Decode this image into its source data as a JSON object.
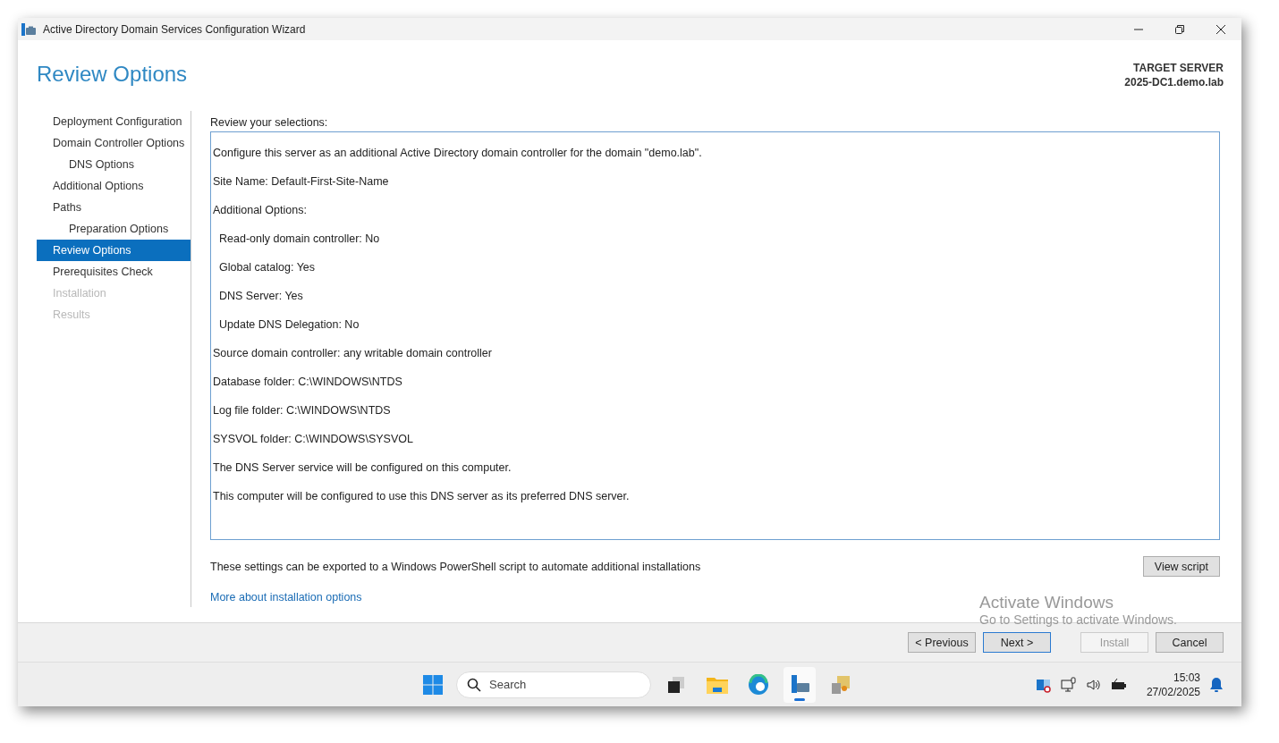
{
  "window": {
    "title": "Active Directory Domain Services Configuration Wizard"
  },
  "page": {
    "heading": "Review Options",
    "target_label": "TARGET SERVER",
    "target_name": "2025-DC1.demo.lab"
  },
  "steps": [
    {
      "label": "Deployment Configuration",
      "selected": false,
      "disabled": false
    },
    {
      "label": "Domain Controller Options",
      "selected": false,
      "disabled": false,
      "children": [
        {
          "label": "DNS Options",
          "selected": false,
          "disabled": false
        }
      ]
    },
    {
      "label": "Additional Options",
      "selected": false,
      "disabled": false
    },
    {
      "label": "Paths",
      "selected": false,
      "disabled": false,
      "children": [
        {
          "label": "Preparation Options",
          "selected": false,
          "disabled": false
        }
      ]
    },
    {
      "label": "Review Options",
      "selected": true,
      "disabled": false
    },
    {
      "label": "Prerequisites Check",
      "selected": false,
      "disabled": false
    },
    {
      "label": "Installation",
      "selected": false,
      "disabled": true
    },
    {
      "label": "Results",
      "selected": false,
      "disabled": true
    }
  ],
  "review": {
    "label": "Review your selections:",
    "lines": [
      {
        "text": "Configure this server as an additional Active Directory domain controller for the domain \"demo.lab\"."
      },
      {
        "text": "Site Name: Default-First-Site-Name"
      },
      {
        "text": "Additional Options:",
        "children": [
          {
            "text": "Read-only domain controller: No"
          },
          {
            "text": "Global catalog: Yes"
          },
          {
            "text": "DNS Server: Yes"
          },
          {
            "text": "Update DNS Delegation: No"
          }
        ]
      },
      {
        "text": "Source domain controller: any writable domain controller"
      },
      {
        "text": "Database folder: C:\\WINDOWS\\NTDS"
      },
      {
        "text": "Log file folder: C:\\WINDOWS\\NTDS"
      },
      {
        "text": "SYSVOL folder: C:\\WINDOWS\\SYSVOL"
      },
      {
        "text": "The DNS Server service will be configured on this computer."
      },
      {
        "text": "This computer will be configured to use this DNS server as its preferred DNS server."
      }
    ]
  },
  "export_note": "These settings can be exported to a Windows PowerShell script to automate additional installations",
  "view_script_button": "View script",
  "more_link": "More about installation options",
  "activation": {
    "title": "Activate Windows",
    "subtitle": "Go to Settings to activate Windows."
  },
  "buttons": [
    {
      "label": "< Previous",
      "disabled": false,
      "default": false
    },
    {
      "label": "Next >",
      "disabled": false,
      "default": true
    },
    {
      "label": "Install",
      "disabled": true,
      "default": false
    },
    {
      "label": "Cancel",
      "disabled": false,
      "default": false
    }
  ],
  "taskbar": {
    "search_placeholder": "Search",
    "apps": [
      {
        "kind": "taskview",
        "active": false
      },
      {
        "kind": "folder",
        "active": false
      },
      {
        "kind": "browser",
        "active": false
      },
      {
        "kind": "server",
        "active": true
      },
      {
        "kind": "installer",
        "active": false
      }
    ],
    "time": "15:03",
    "date": "27/02/2025"
  }
}
